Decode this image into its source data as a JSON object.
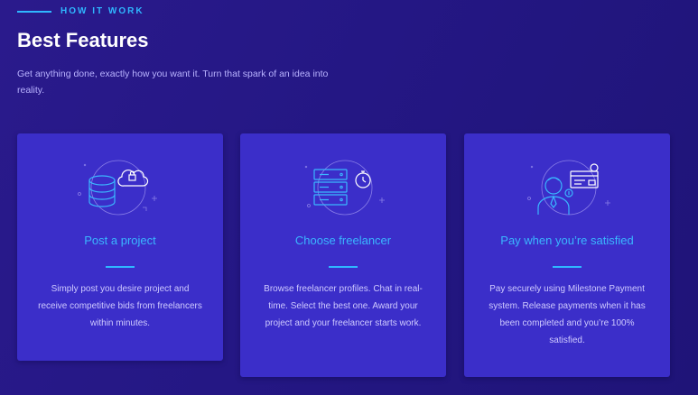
{
  "section": {
    "eyebrow": "HOW IT WORK",
    "title": "Best Features",
    "subtitle": "Get anything done, exactly how you want it. Turn that spark of an idea into reality."
  },
  "features": [
    {
      "icon": "database-cloud-icon",
      "title": "Post a project",
      "description": "Simply post you desire project and receive competitive bids from freelancers within minutes."
    },
    {
      "icon": "server-timer-icon",
      "title": "Choose freelancer",
      "description": "Browse freelancer profiles. Chat in real-time. Select the best one. Award your project and your freelancer starts work."
    },
    {
      "icon": "user-payment-icon",
      "title": "Pay when you’re satisfied",
      "description": "Pay securely using Milestone Payment system. Release payments when it has been completed and you’re 100% satisfied."
    }
  ],
  "colors": {
    "background": "#241784",
    "card": "#3b2ec9",
    "accent": "#2fb7ff",
    "text_muted": "#cfcaff"
  }
}
